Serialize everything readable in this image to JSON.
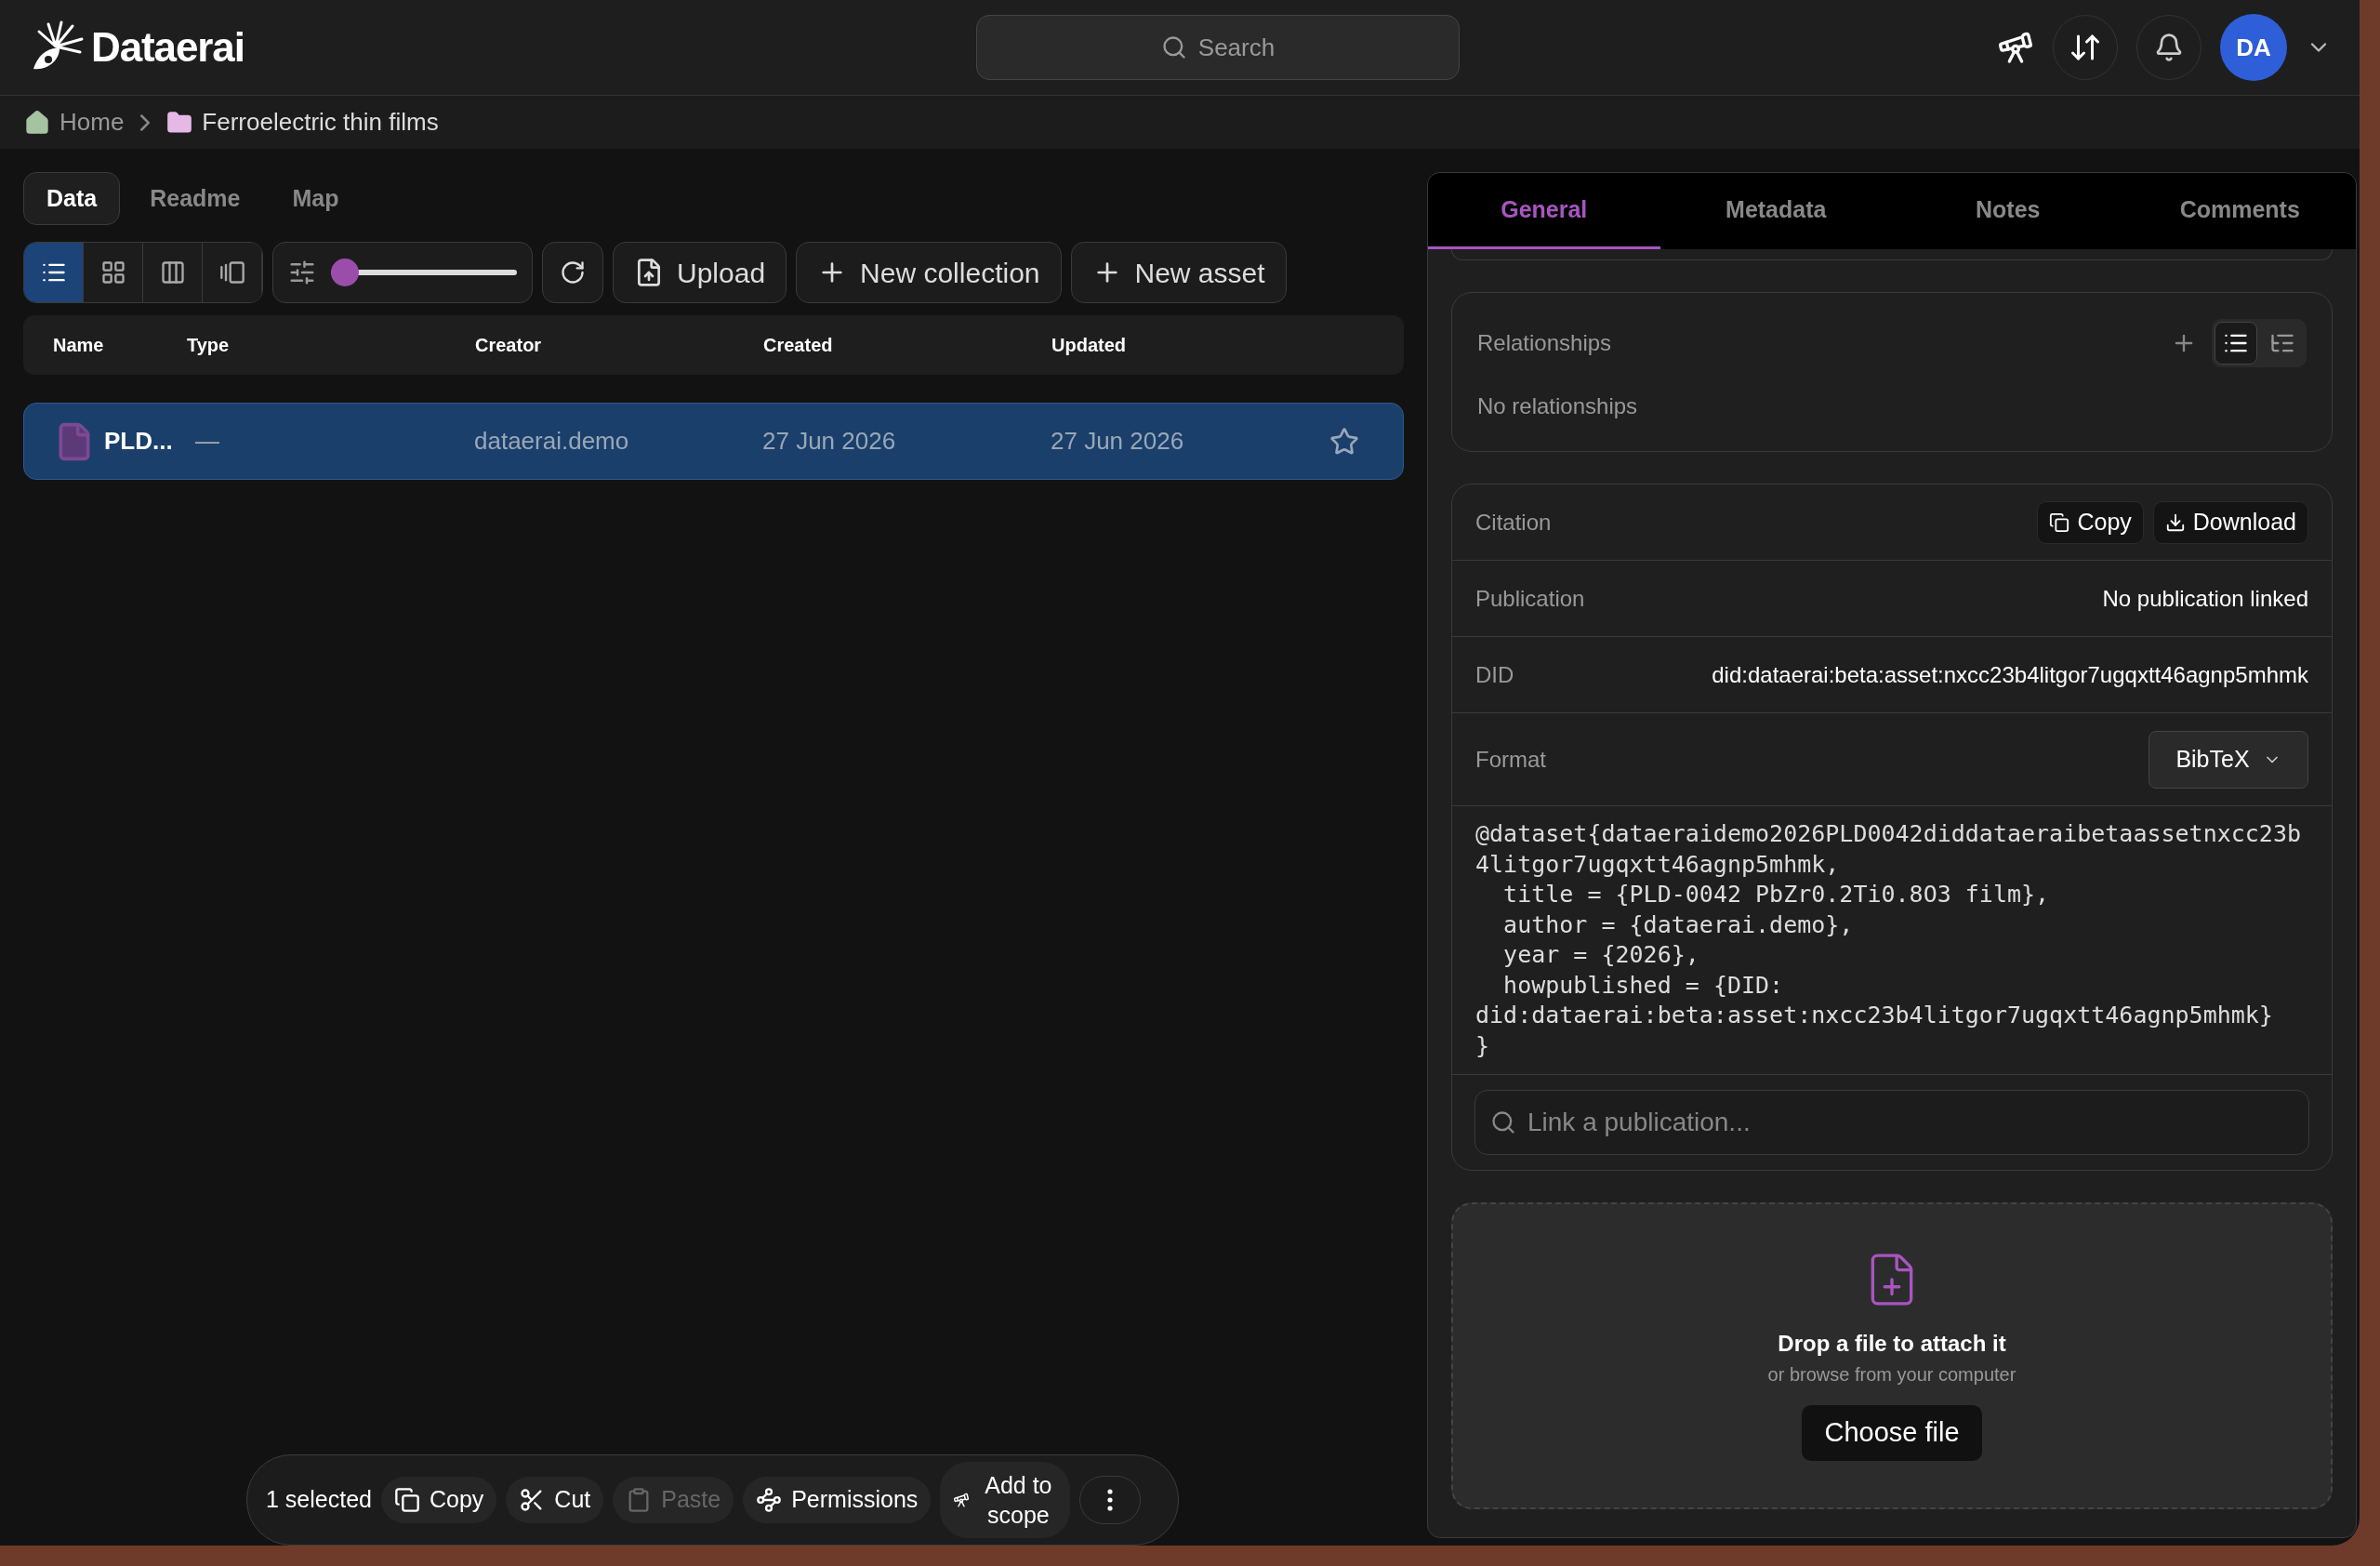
{
  "app": {
    "logo": "Dataerai"
  },
  "search": {
    "placeholder": "Search"
  },
  "user": {
    "initials": "DA"
  },
  "breadcrumb": [
    {
      "label": "Home",
      "kind": "home"
    },
    {
      "label": "Ferroelectric thin films",
      "kind": "folder"
    }
  ],
  "view_tabs": [
    {
      "label": "Data",
      "selected": true
    },
    {
      "label": "Readme",
      "selected": false
    },
    {
      "label": "Map",
      "selected": false
    }
  ],
  "view_modes": [
    {
      "kind": "list",
      "selected": true
    },
    {
      "kind": "grid",
      "selected": false
    },
    {
      "kind": "columns",
      "selected": false
    },
    {
      "kind": "gallery",
      "selected": false
    }
  ],
  "size_slider": {
    "level": 0.0
  },
  "toolbar_buttons": [
    {
      "label": "Upload",
      "kind": "upload"
    },
    {
      "label": "New collection",
      "kind": "add"
    },
    {
      "label": "New asset",
      "kind": "add"
    }
  ],
  "table": {
    "columns": [
      "Name",
      "Type",
      "Creator",
      "Created",
      "Updated"
    ],
    "rows": [
      {
        "name": "PLD...",
        "type": "—",
        "creator": "dataerai.demo",
        "created": "27 Jun 2026",
        "updated": "27 Jun 2026",
        "selected": true,
        "starred": false
      }
    ]
  },
  "detail_tabs": [
    {
      "label": "General",
      "selected": true
    },
    {
      "label": "Metadata",
      "selected": false
    },
    {
      "label": "Notes",
      "selected": false
    },
    {
      "label": "Comments",
      "selected": false
    }
  ],
  "relationships": {
    "title": "Relationships",
    "empty": "No relationships",
    "view_modes": [
      {
        "kind": "list",
        "selected": true
      },
      {
        "kind": "tree",
        "selected": false
      }
    ]
  },
  "citation": {
    "title": "Citation",
    "actions": [
      {
        "label": "Copy",
        "kind": "copy"
      },
      {
        "label": "Download",
        "kind": "download"
      }
    ],
    "fields": [
      {
        "label": "Publication",
        "value": "No publication linked"
      },
      {
        "label": "DID",
        "value": "did:dataerai:beta:asset:nxcc23b4litgor7ugqxtt46agnp5mhmk"
      }
    ],
    "format": {
      "label": "Format",
      "value": "BibTeX"
    },
    "bibtex": "@dataset{dataeraidemo2026PLD0042diddataeraibetaassetnxcc23b4litgor7ugqxtt46agnp5mhmk,\n  title = {PLD-0042 PbZr0.2Ti0.8O3 film},\n  author = {dataerai.demo},\n  year = {2026},\n  howpublished = {DID: did:dataerai:beta:asset:nxcc23b4litgor7ugqxtt46agnp5mhmk}\n}",
    "link_placeholder": "Link a publication..."
  },
  "dropzone": {
    "title": "Drop a file to attach it",
    "subtitle": "or browse from your computer",
    "button": "Choose file"
  },
  "selection_bar": {
    "count": "1 selected",
    "actions": [
      {
        "label": "Copy",
        "kind": "copy",
        "disabled": false
      },
      {
        "label": "Cut",
        "kind": "cut",
        "disabled": false
      },
      {
        "label": "Paste",
        "kind": "paste",
        "disabled": true
      },
      {
        "label": "Permissions",
        "kind": "permissions",
        "disabled": false
      },
      {
        "label": "Add to scope",
        "kind": "scope",
        "disabled": false
      }
    ]
  }
}
